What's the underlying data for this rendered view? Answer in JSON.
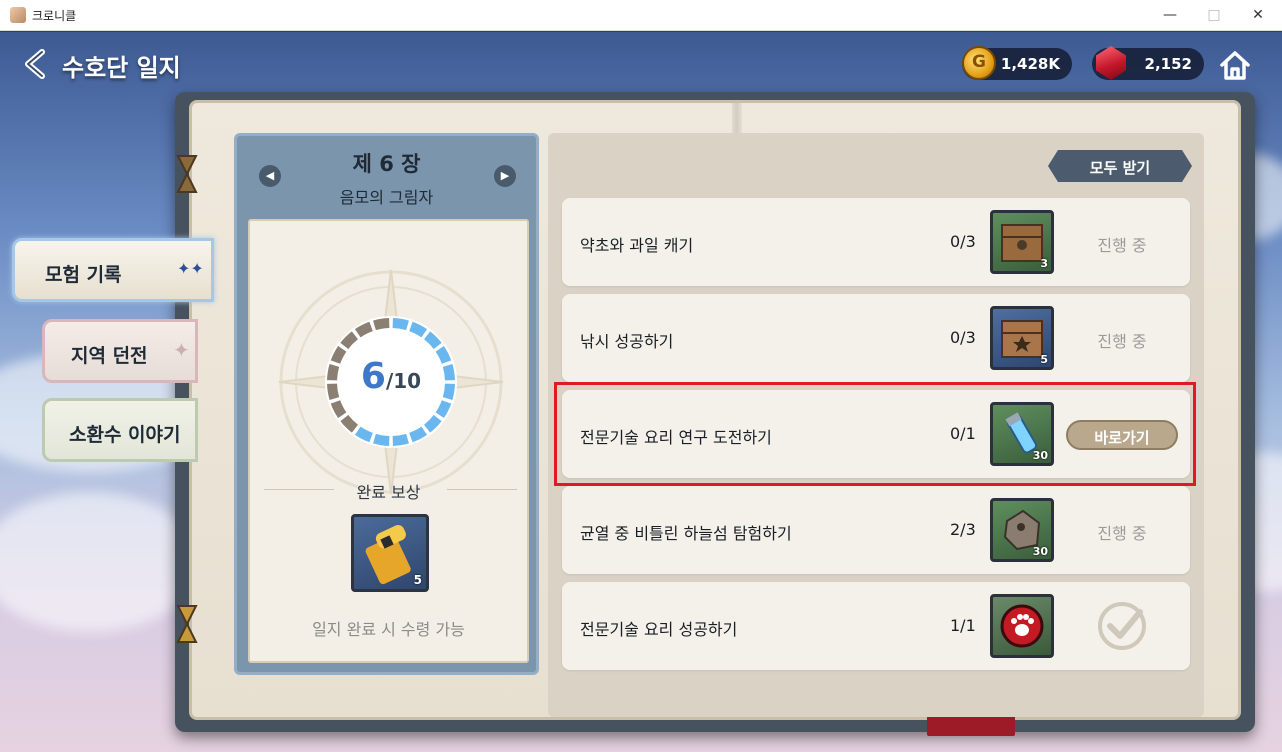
{
  "window": {
    "title": "크로니클"
  },
  "header": {
    "title": "수호단 일지",
    "gold": "1,428K",
    "gems": "2,152",
    "back_icon": "chevron-left-icon",
    "home_icon": "home-icon"
  },
  "tabs": [
    {
      "label": "모험 기록",
      "selected": true
    },
    {
      "label": "지역 던전",
      "selected": false
    },
    {
      "label": "소환수 이야기",
      "selected": false
    }
  ],
  "chapter": {
    "title": "제 6 장",
    "subtitle": "음모의 그림자",
    "progress_done": "6",
    "progress_total": "/10",
    "progress_fraction": 0.6,
    "reward_title": "완료 보상",
    "reward_count": "5",
    "reward_icon": "scroll-icon",
    "reward_note": "일지 완료 시 수령 가능"
  },
  "quest_list": {
    "receive_all_label": "모두 받기",
    "quests": [
      {
        "name": "약초와 과일 캐기",
        "progress": "0/3",
        "item_count": "3",
        "item_icon": "chest-icon",
        "status": "진행 중",
        "action": null
      },
      {
        "name": "낚시 성공하기",
        "progress": "0/3",
        "item_count": "5",
        "item_icon": "chest-icon",
        "status": "진행 중",
        "action": null
      },
      {
        "name": "전문기술 요리 연구 도전하기",
        "progress": "0/1",
        "item_count": "30",
        "item_icon": "potion-vial-icon",
        "status": null,
        "action": "바로가기"
      },
      {
        "name": "균열 중 비틀린 하늘섬 탐험하기",
        "progress": "2/3",
        "item_count": "30",
        "item_icon": "ore-stone-icon",
        "status": "진행 중",
        "action": null
      },
      {
        "name": "전문기술 요리 성공하기",
        "progress": "1/1",
        "item_count": "",
        "item_icon": "paw-emblem-icon",
        "status": "completed",
        "action": null
      }
    ]
  },
  "colors": {
    "highlight": "#e01a22",
    "accent_blue": "#3e78c9",
    "go_button": "#b9a88c",
    "chapter_panel": "#7b95ad"
  }
}
